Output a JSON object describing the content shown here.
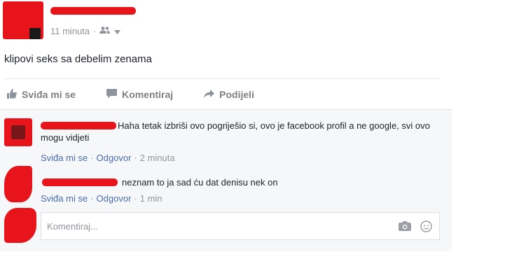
{
  "post": {
    "timestamp": "11 minuta",
    "audience_icon": "friends-icon",
    "text": "klipovi seks sa debelim zenama"
  },
  "actions": {
    "like": "Sviđa mi se",
    "comment": "Komentiraj",
    "share": "Podijeli"
  },
  "comments": [
    {
      "text": "Haha tetak izbriši ovo pogriješio si, ovo je facebook profil a ne google, svi ovo mogu vidjeti",
      "like": "Sviđa mi se",
      "reply": "Odgovor",
      "time": "2 minuta"
    },
    {
      "text": "neznam to ja sad ću dat denisu nek on",
      "like": "Sviđa mi se",
      "reply": "Odgovor",
      "time": "1 min"
    }
  ],
  "reply_box": {
    "placeholder": "Komentiraj...",
    "icons": [
      "camera-icon",
      "emoji-icon"
    ]
  },
  "colors": {
    "redaction": "#e8141c",
    "link": "#4b6cab",
    "meta": "#90949c",
    "action": "#7f7f7f"
  }
}
